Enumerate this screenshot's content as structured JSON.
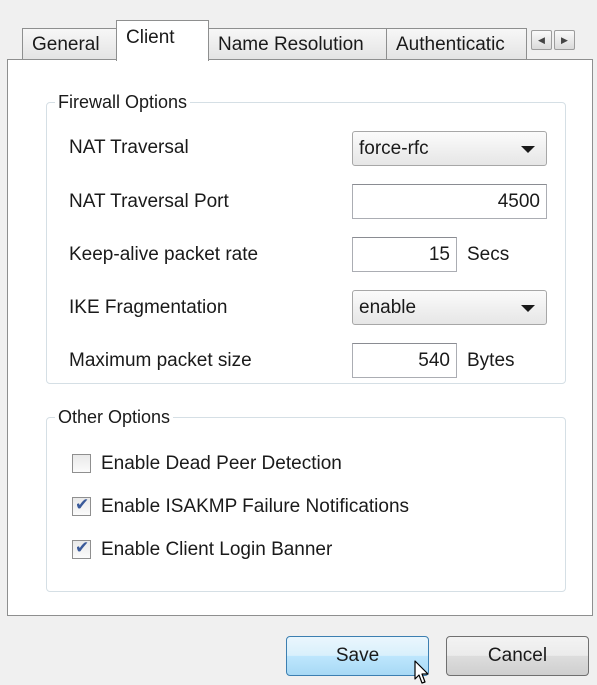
{
  "tabs": [
    {
      "label": "General"
    },
    {
      "label": "Client"
    },
    {
      "label": "Name Resolution"
    },
    {
      "label": "Authenticatic"
    }
  ],
  "active_tab": "Client",
  "tab_scroll": {
    "left_icon": "arrow-left-icon",
    "right_icon": "arrow-right-icon"
  },
  "firewall": {
    "title": "Firewall Options",
    "nat_traversal": {
      "label": "NAT Traversal",
      "value": "force-rfc"
    },
    "nat_port": {
      "label": "NAT Traversal Port",
      "value": "4500"
    },
    "keepalive": {
      "label": "Keep-alive packet rate",
      "value": "15",
      "unit": "Secs"
    },
    "ike_frag": {
      "label": "IKE Fragmentation",
      "value": "enable"
    },
    "max_packet": {
      "label": "Maximum packet size",
      "value": "540",
      "unit": "Bytes"
    }
  },
  "other": {
    "title": "Other Options",
    "options": [
      {
        "label": "Enable Dead Peer Detection",
        "checked": false
      },
      {
        "label": "Enable ISAKMP Failure Notifications",
        "checked": true
      },
      {
        "label": "Enable Client Login Banner",
        "checked": true
      }
    ]
  },
  "buttons": {
    "save": "Save",
    "cancel": "Cancel"
  },
  "colors": {
    "window_bg": "#f0f0f0",
    "page_bg": "#ffffff",
    "check_tick": "#3a5a9a",
    "save_button": "#bee6fd"
  }
}
